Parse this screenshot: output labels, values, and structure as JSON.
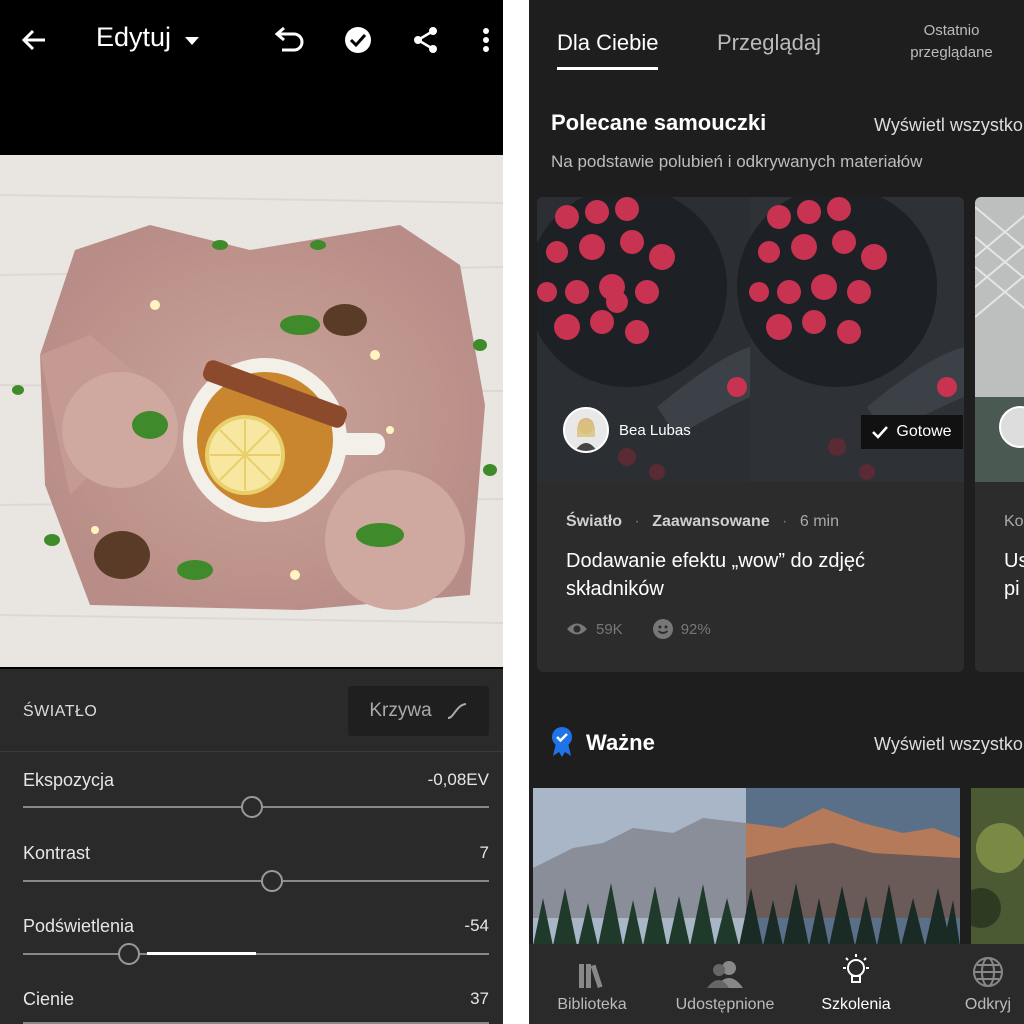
{
  "editor": {
    "title": "Edytuj",
    "section_label": "ŚWIATŁO",
    "curve_label": "Krzywa",
    "sliders": [
      {
        "label": "Ekspozycja",
        "value": "-0,08EV",
        "position": 0.49
      },
      {
        "label": "Kontrast",
        "value": "7",
        "position": 0.535
      },
      {
        "label": "Podświetlenia",
        "value": "-54",
        "position": 0.23
      },
      {
        "label": "Cienie",
        "value": "37",
        "position": 0.685
      }
    ]
  },
  "learn": {
    "tabs": [
      "Dla Ciebie",
      "Przeglądaj",
      "Ostatnio przeglądane"
    ],
    "tutorials": {
      "title": "Polecane samouczki",
      "see_all": "Wyświetl wszystko",
      "subtitle": "Na podstawie polubień i odkrywanych materiałów",
      "card": {
        "author": "Bea Lubas",
        "badge": "Gotowe",
        "category": "Światło",
        "level": "Zaawansowane",
        "duration": "6 min",
        "title": "Dodawanie efektu „wow” do zdjęć składników",
        "views": "59K",
        "likes": "92%"
      },
      "next_card_partial": {
        "category": "Ko",
        "title_line1": "Us",
        "title_line2": "pi"
      }
    },
    "important": {
      "title": "Ważne",
      "see_all": "Wyświetl wszystko"
    },
    "bottom_nav": [
      {
        "label": "Biblioteka",
        "icon": "library-icon",
        "active": false
      },
      {
        "label": "Udostępnione",
        "icon": "people-icon",
        "active": false
      },
      {
        "label": "Szkolenia",
        "icon": "lightbulb-icon",
        "active": true
      },
      {
        "label": "Odkryj",
        "icon": "globe-icon",
        "active": false
      }
    ]
  },
  "colors": {
    "accent_blue": "#1e73e8",
    "panel_dark": "#2a2a2a",
    "background_dark": "#1e1e1e"
  }
}
